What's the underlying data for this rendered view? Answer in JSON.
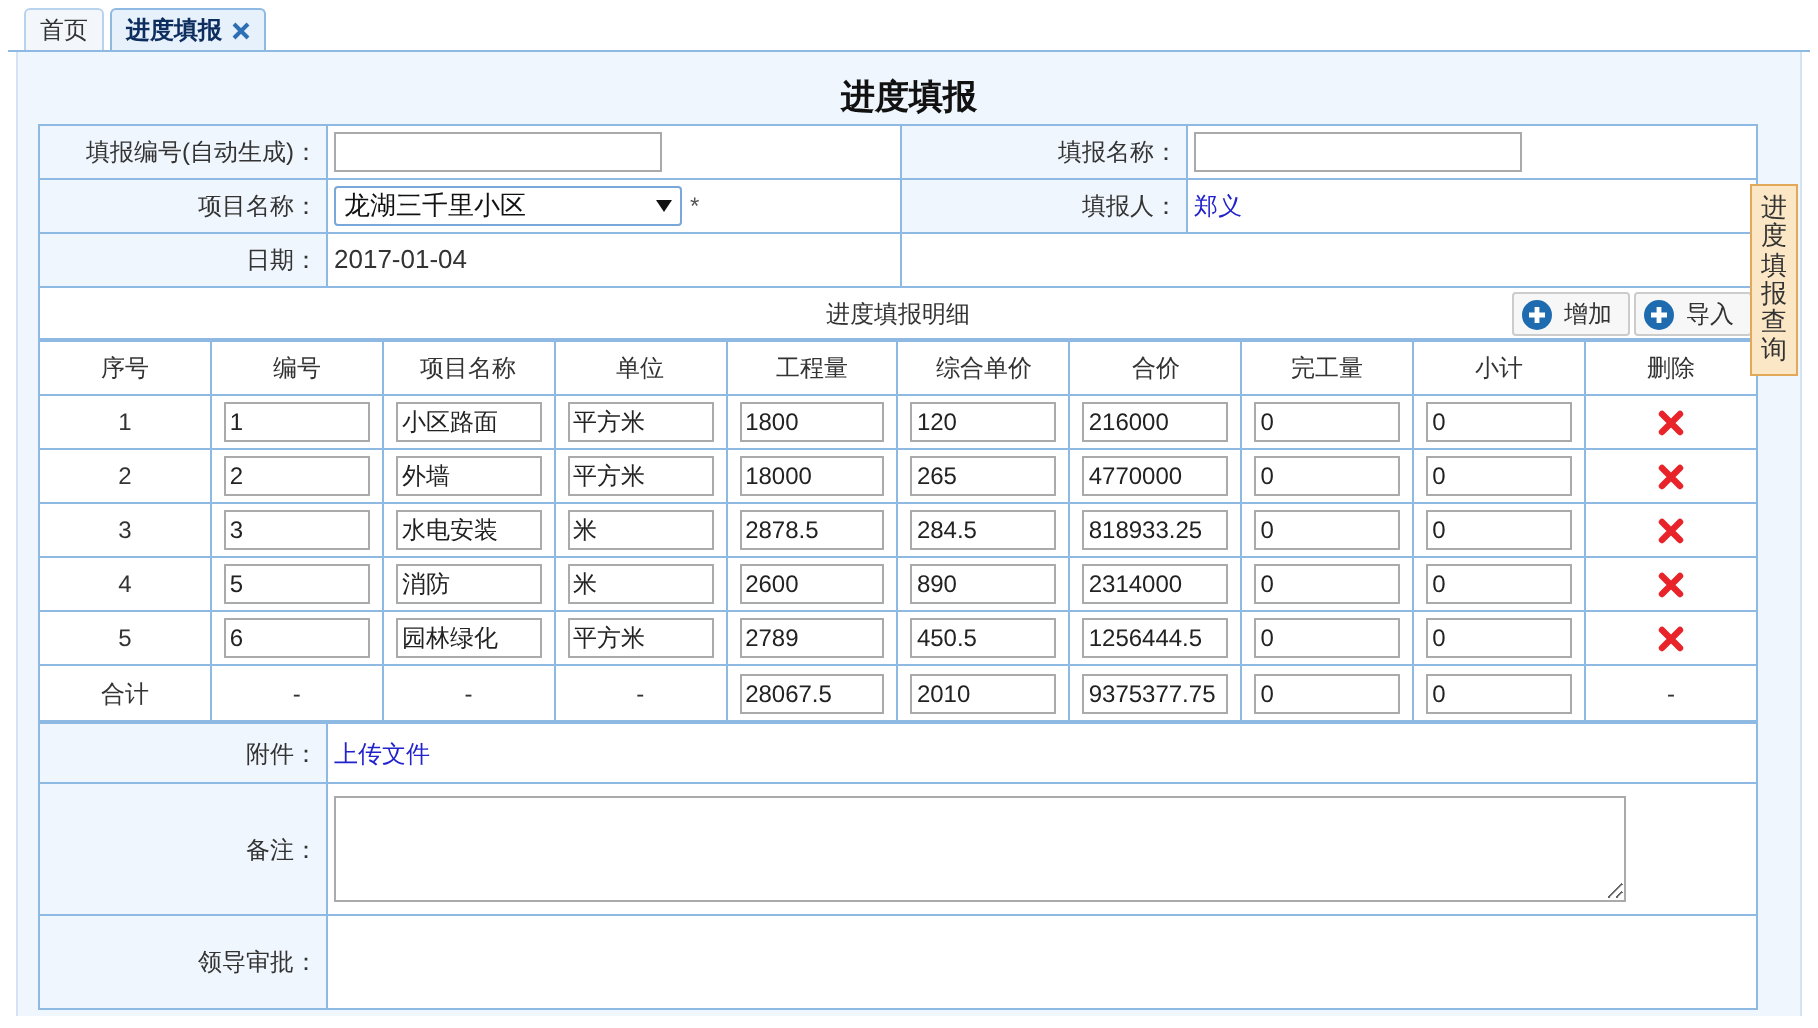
{
  "tabs": [
    {
      "label": "首页",
      "selected": false,
      "closable": false
    },
    {
      "label": "进度填报",
      "selected": true,
      "closable": true
    }
  ],
  "title": "进度填报",
  "form": {
    "report_no_label": "填报编号(自动生成)：",
    "report_name_label": "填报名称：",
    "project_label": "项目名称：",
    "project_value": "龙湖三千里小区",
    "required_mark": "*",
    "reporter_label": "填报人：",
    "reporter_value": "郑义",
    "date_label": "日期：",
    "date_value": "2017-01-04"
  },
  "side_tab": {
    "label": "进度填报查询"
  },
  "detail": {
    "title": "进度填报明细",
    "buttons": [
      "增加",
      "导入"
    ],
    "columns": [
      "序号",
      "编号",
      "项目名称",
      "单位",
      "工程量",
      "综合单价",
      "合价",
      "完工量",
      "小计",
      "删除"
    ],
    "rows": [
      {
        "index": "1",
        "values": [
          "1",
          "小区路面",
          "平方米",
          "1800",
          "120",
          "216000",
          "0",
          "0"
        ]
      },
      {
        "index": "2",
        "values": [
          "2",
          "外墙",
          "平方米",
          "18000",
          "265",
          "4770000",
          "0",
          "0"
        ]
      },
      {
        "index": "3",
        "values": [
          "3",
          "水电安装",
          "米",
          "2878.5",
          "284.5",
          "818933.25",
          "0",
          "0"
        ]
      },
      {
        "index": "4",
        "values": [
          "5",
          "消防",
          "米",
          "2600",
          "890",
          "2314000",
          "0",
          "0"
        ]
      },
      {
        "index": "5",
        "values": [
          "6",
          "园林绿化",
          "平方米",
          "2789",
          "450.5",
          "1256444.5",
          "0",
          "0"
        ]
      }
    ],
    "total": {
      "label": "合计",
      "cells": [
        {
          "kind": "text",
          "text": "-"
        },
        {
          "kind": "text",
          "text": "-"
        },
        {
          "kind": "text",
          "text": "-"
        },
        {
          "kind": "input",
          "text": "28067.5"
        },
        {
          "kind": "input",
          "text": "2010"
        },
        {
          "kind": "input",
          "text": "9375377.75"
        },
        {
          "kind": "input",
          "text": "0"
        },
        {
          "kind": "input",
          "text": "0"
        },
        {
          "kind": "text",
          "text": "-"
        }
      ]
    }
  },
  "attachment": {
    "label": "附件：",
    "link": "上传文件"
  },
  "remark": {
    "label": "备注："
  },
  "approval": {
    "label": "领导审批："
  }
}
